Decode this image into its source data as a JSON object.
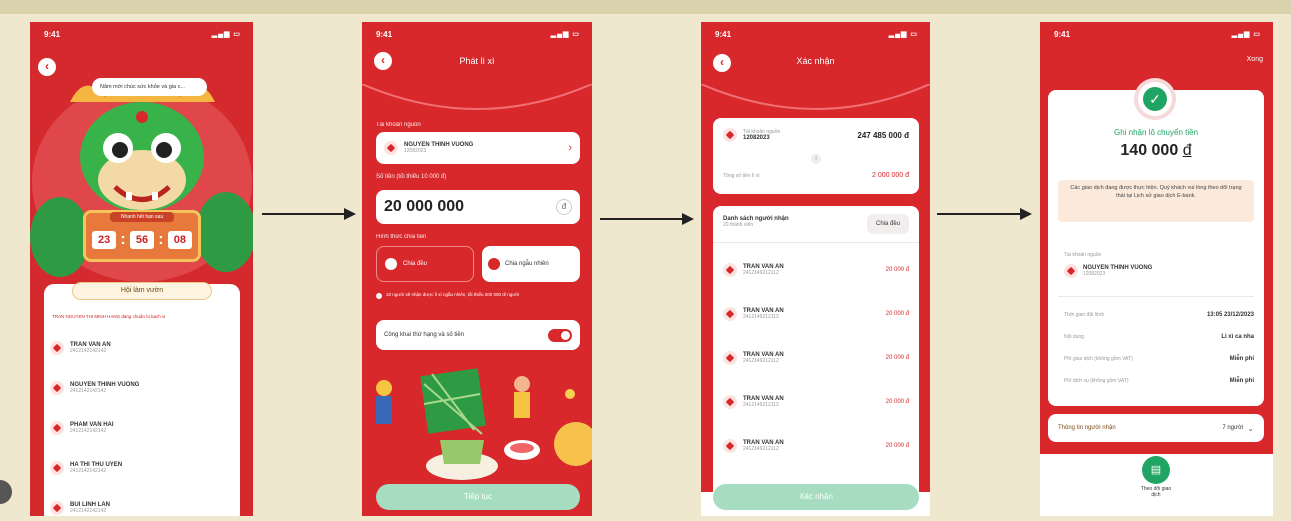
{
  "status_time": "9:41",
  "screen1": {
    "speech": "Năm mới chúc sức khỏe và gia c...",
    "countdown_label": "Nhanh hết hạn sau",
    "countdown": [
      "23",
      "56",
      "08"
    ],
    "banner": "Hội làm vườn",
    "notice": "TRAN NGUYEN THI MINH HANG đang chuẩn bị bạch vi",
    "people": [
      {
        "name": "TRAN VAN AN",
        "phone": "2412142142142"
      },
      {
        "name": "NGUYEN THINH VUONG",
        "phone": "2412142142142"
      },
      {
        "name": "PHAM VAN HAI",
        "phone": "2412142142142"
      },
      {
        "name": "HA THI THU UYEN",
        "phone": "2412142142142"
      },
      {
        "name": "BUI LINH LAN",
        "phone": "2412142142142"
      }
    ]
  },
  "screen2": {
    "title": "Phát lì xì",
    "source_label": "Tài khoản nguồn",
    "source_name": "NGUYEN THINH VUONG",
    "source_number": "12082023",
    "amount_label": "Số tiền (tối thiểu 10 000 đ)",
    "amount": "20 000 000",
    "currency": "đ",
    "method_label": "Hình thức chia tiền",
    "opt_equal": "Chia đều",
    "opt_random": "Chia ngẫu nhiên",
    "note": "10 người sẽ nhận được lì xì ngẫu nhiên, tối thiểu 200 000 đ/ người",
    "public_label": "Công khai thứ hạng và số tiền",
    "continue": "Tiếp tục"
  },
  "screen3": {
    "title": "Xác nhận",
    "acct_caption": "Tài khoản nguồn",
    "acct_number": "12082023",
    "acct_balance": "247 485 000 đ",
    "total_label": "Tổng số tiền lì xì",
    "total": "2 000 000 đ",
    "list_title": "Danh sách người nhận",
    "list_sub": "20 thành viên",
    "split_btn": "Chia đều",
    "recipients": [
      {
        "name": "TRAN VAN AN",
        "phone": "2412149212112",
        "amount": "20 000 đ"
      },
      {
        "name": "TRAN VAN AN",
        "phone": "2412149212112",
        "amount": "20 000 đ"
      },
      {
        "name": "TRAN VAN AN",
        "phone": "2412149212112",
        "amount": "20 000 đ"
      },
      {
        "name": "TRAN VAN AN",
        "phone": "2412149212112",
        "amount": "20 000 đ"
      },
      {
        "name": "TRAN VAN AN",
        "phone": "2412149212112",
        "amount": "20 000 đ"
      }
    ],
    "confirm": "Xác nhận"
  },
  "screen4": {
    "close": "Xong",
    "success": "Ghi nhận lô chuyển tiền",
    "amount": "140 000",
    "currency": "đ",
    "info": "Các giao dịch đang được thực hiện. Quý khách vui lòng theo dõi trạng thái tại Lịch sử giao dịch E-bank.",
    "source_label": "Tài khoản nguồn",
    "source_name": "NGUYEN THINH VUONG",
    "source_number": "12082023",
    "details": [
      {
        "k": "Thời gian đặt lệnh",
        "v": "13:05 23/12/2023"
      },
      {
        "k": "Nội dung",
        "v": "Lì xì ca nha"
      },
      {
        "k": "Phí giao dịch (không gồm VAT)",
        "v": "Miễn phí"
      },
      {
        "k": "Phí dịch vụ (không gồm VAT)",
        "v": "Miễn phí"
      }
    ],
    "recipient_label": "Thông tin người nhận",
    "recipient_count": "7 người",
    "track_label": "Theo dõi giao dịch"
  },
  "colors": {
    "primary": "#d8282c",
    "success": "#1fa463",
    "button_disabled": "#a6ddc0"
  }
}
